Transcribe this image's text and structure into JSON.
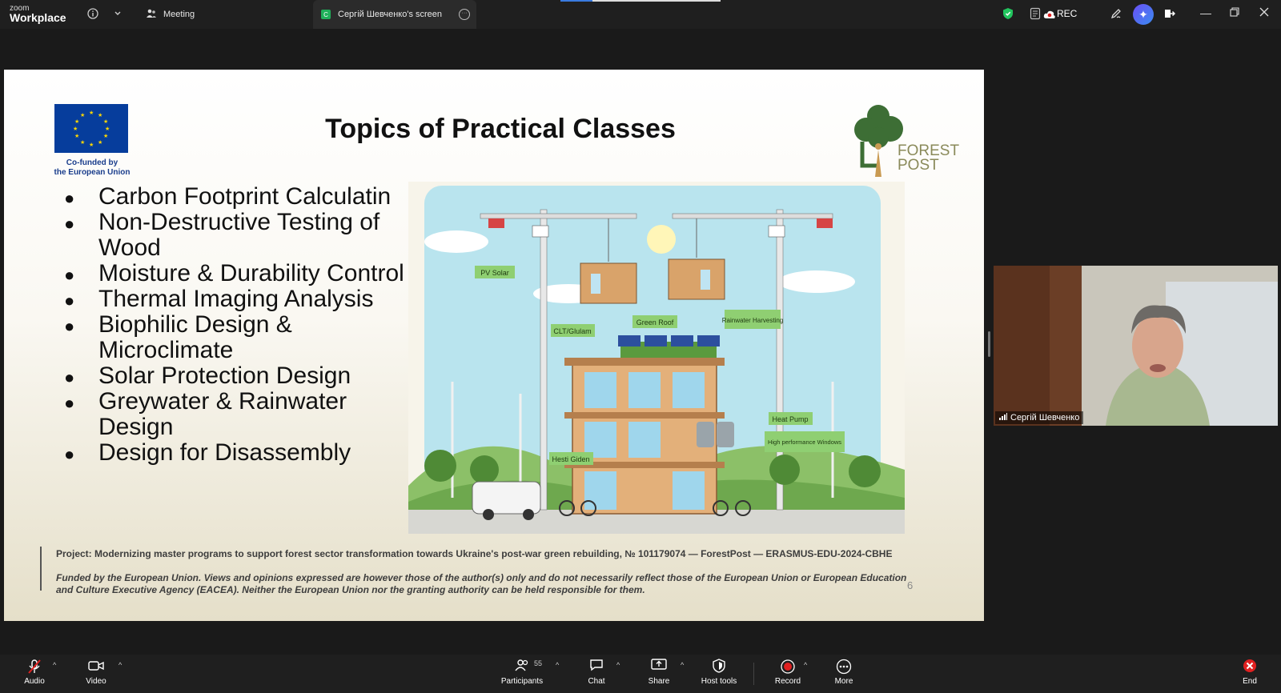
{
  "app": {
    "brand_small": "zoom",
    "brand_large": "Workplace"
  },
  "tabs": [
    {
      "label": "Meeting",
      "icon": "people-icon"
    },
    {
      "label": "Сергій Шевченко's screen",
      "badge": "C",
      "icon": "screen-share-icon"
    }
  ],
  "topbar": {
    "rec_label": "REC"
  },
  "slide": {
    "title": "Topics of Practical Classes",
    "eu_caption_line1": "Co-funded by",
    "eu_caption_line2": "the European Union",
    "logo_line1": "FOREST",
    "logo_line2": "POST",
    "topics": [
      "Carbon Footprint Calculatin",
      "Non-Destructive Testing of Wood",
      "Moisture & Durability Control",
      "Thermal Imaging Analysis",
      "Biophilic Design & Microclimate",
      "Solar Protection Design",
      "Greywater & Rainwater Design",
      "Design for Disassembly"
    ],
    "illustration_labels": [
      "PV Solar",
      "CLT/Glulam",
      "Green Roof",
      "Rainwater Harvesting",
      "Heat Pump",
      "High performance Windows",
      "Hesti Giden"
    ],
    "project_text": "Project: Modernizing master programs to support forest sector transformation towards Ukraine's post-war green rebuilding, № 101179074 — ForestPost — ERASMUS-EDU-2024-CBHE",
    "funded_text": "Funded by the European Union. Views and opinions expressed are however those of the author(s) only and do not necessarily reflect those of the European Union or European Education and Culture Executive Agency (EACEA). Neither the European Union nor the granting authority can be held responsible for them.",
    "page_number": "6"
  },
  "video": {
    "participant_name": "Сергій Шевченко"
  },
  "toolbar": {
    "audio": "Audio",
    "video": "Video",
    "participants": "Participants",
    "participants_count": "55",
    "chat": "Chat",
    "share": "Share",
    "host_tools": "Host tools",
    "record": "Record",
    "more": "More",
    "end": "End"
  },
  "colors": {
    "accent_blue": "#3a7be0",
    "record_red": "#e02020",
    "eu_blue": "#063d9c",
    "eu_gold": "#ffd700",
    "share_green": "#1fb05a"
  }
}
